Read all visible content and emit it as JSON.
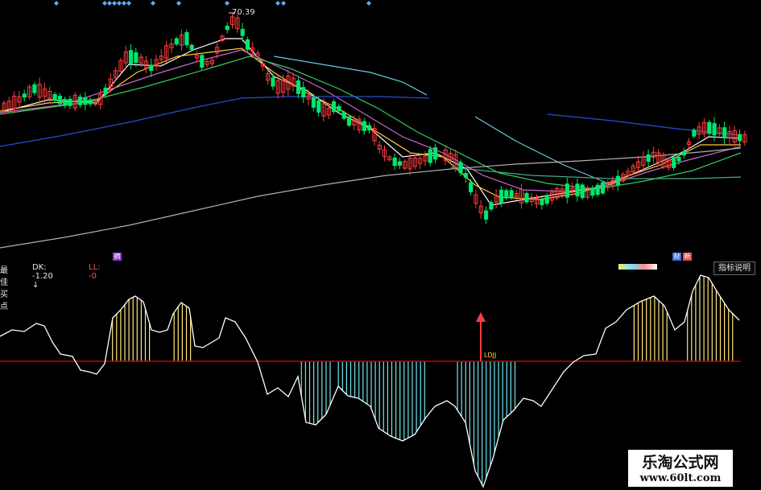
{
  "price_panel": {
    "high_label": "70.39",
    "marker_a": "摘",
    "marker_b": "财",
    "marker_c": "新"
  },
  "indicator_panel": {
    "title": "最佳买点",
    "dk_text": "DK: -1.20 ↓",
    "ll_text": "LL: -0",
    "help_button": "指标说明",
    "signal_label": "LDJJ"
  },
  "watermark": {
    "title": "乐淘公式网",
    "url": "www.60lt.com"
  },
  "colors": {
    "up_candle": "#ff3c3c",
    "down_candle": "#00e66e",
    "positive_bar": "#ffe678",
    "negative_bar": "#6ee6f0",
    "zero_line": "#c80000",
    "oscillator": "#ffffff",
    "signal_arrow": "#ff3c3c"
  }
}
